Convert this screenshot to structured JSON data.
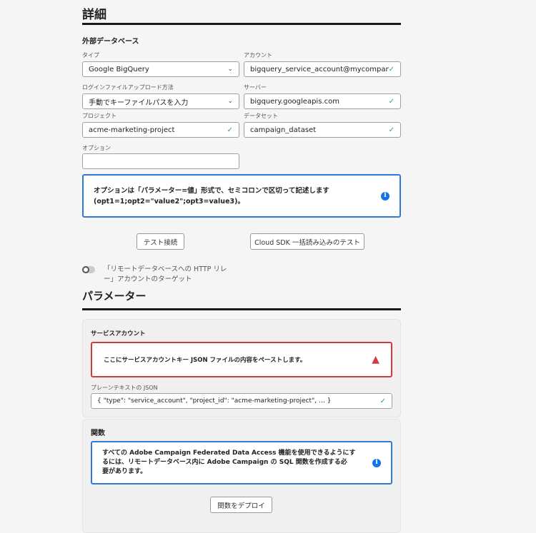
{
  "details": {
    "title": "詳細",
    "section": "外部データベース",
    "type_label": "タイプ",
    "type_value": "Google BigQuery",
    "account_label": "アカウント",
    "account_value": "bigquery_service_account@mycompany.iam...",
    "upload_label": "ログインファイルアップロード方法",
    "upload_value": "手動でキーファイルパスを入力",
    "server_label": "サーバー",
    "server_value": "bigquery.googleapis.com",
    "project_label": "プロジェクト",
    "project_value": "acme-marketing-project",
    "dataset_label": "データセット",
    "dataset_value": "campaign_dataset",
    "options_label": "オプション",
    "options_value": "",
    "options_info_line1": "オプションは「パラメーター=値」形式で、セミコロンで区切って記述します",
    "options_info_line2": "(opt1=1;opt2=\"value2\";opt3=value3)。",
    "test_connection": "テスト接続",
    "test_cloud_sdk": "Cloud SDK 一括読み込みのテスト",
    "toggle_line1": "「リモートデータベースへの HTTP リレ",
    "toggle_line2": "ー」アカウントのターゲット"
  },
  "parameters": {
    "title": "パラメーター",
    "service_account": "サービスアカウント",
    "error_text": "ここにサービスアカウントキー JSON ファイルの内容をペーストします。",
    "json_label": "プレーンテキストの JSON",
    "json_value": "{ \"type\": \"service_account\", \"project_id\": \"acme-marketing-project\", … }",
    "functions_title": "関数",
    "functions_info_1": "すべての Adobe Campaign Federated Data Access 機能を使用できるようにす",
    "functions_info_2": "るには、リモートデータベース内に Adobe Campaign の SQL 関数を作成する必",
    "functions_info_3": "要があります。",
    "deploy": "関数をデプロイ"
  },
  "colors": {
    "accent": "#1473e6",
    "error": "#d7373f",
    "success": "#2d9d78"
  }
}
